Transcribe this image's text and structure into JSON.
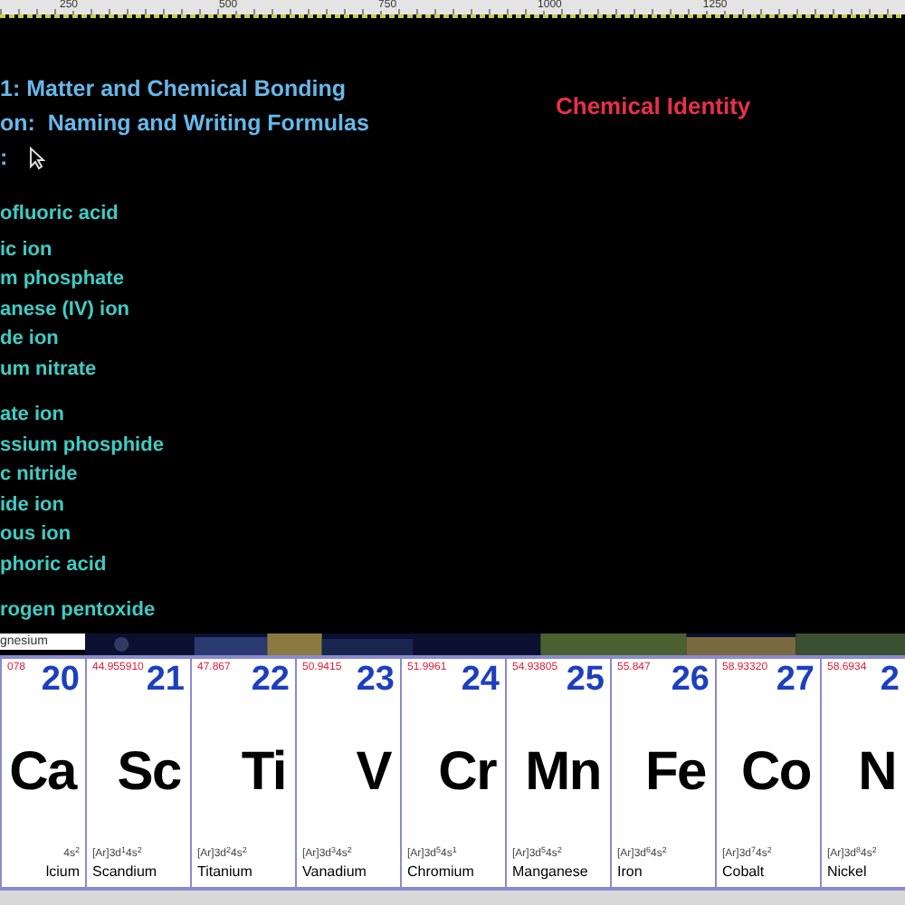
{
  "ruler": {
    "labels": [
      "250",
      "500",
      "750",
      "1000",
      "1250"
    ]
  },
  "heading": {
    "lines": [
      "1: Matter and Chemical Bonding",
      "on:  Naming and Writing Formulas",
      ":"
    ]
  },
  "slide_title": "Chemical Identity",
  "groups": [
    {
      "items": [
        "ofluoric acid",
        "ic ion",
        "m phosphate",
        "anese (IV) ion",
        "de ion",
        "um nitrate"
      ]
    },
    {
      "items": [
        "ate ion",
        "ssium phosphide",
        "c nitride",
        "ide ion",
        "ous ion",
        "phoric acid"
      ]
    },
    {
      "items": [
        "rogen pentoxide"
      ]
    }
  ],
  "table": {
    "top_label": "gnesium",
    "elements": [
      {
        "mass": "078",
        "number": "20",
        "symbol": "Ca",
        "config": "4s$^{2}$",
        "name": "lcium"
      },
      {
        "mass": "44.955910",
        "number": "21",
        "symbol": "Sc",
        "config": "[Ar]3d$^{1}$4s$^{2}$",
        "name": "Scandium"
      },
      {
        "mass": "47.867",
        "number": "22",
        "symbol": "Ti",
        "config": "[Ar]3d$^{2}$4s$^{2}$",
        "name": "Titanium"
      },
      {
        "mass": "50.9415",
        "number": "23",
        "symbol": "V",
        "config": "[Ar]3d$^{3}$4s$^{2}$",
        "name": "Vanadium"
      },
      {
        "mass": "51.9961",
        "number": "24",
        "symbol": "Cr",
        "config": "[Ar]3d$^{5}$4s$^{1}$",
        "name": "Chromium"
      },
      {
        "mass": "54.93805",
        "number": "25",
        "symbol": "Mn",
        "config": "[Ar]3d$^{5}$4s$^{2}$",
        "name": "Manganese"
      },
      {
        "mass": "55.847",
        "number": "26",
        "symbol": "Fe",
        "config": "[Ar]3d$^{6}$4s$^{2}$",
        "name": "Iron"
      },
      {
        "mass": "58.93320",
        "number": "27",
        "symbol": "Co",
        "config": "[Ar]3d$^{7}$4s$^{2}$",
        "name": "Cobalt"
      },
      {
        "mass": "58.6934",
        "number": "2",
        "symbol": "N",
        "config": "[Ar]3d$^{8}$4s$^{2}$",
        "name": "Nickel"
      }
    ]
  }
}
